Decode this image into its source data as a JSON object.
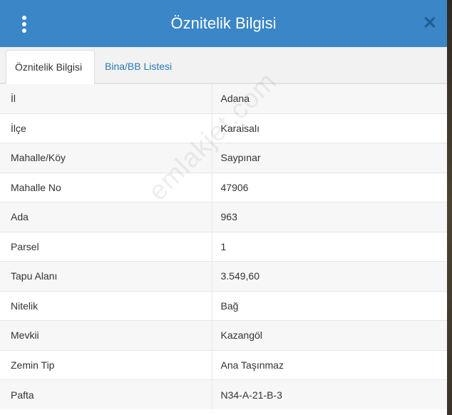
{
  "header": {
    "title": "Öznitelik Bilgisi"
  },
  "tabs": [
    {
      "label": "Öznitelik Bilgisi",
      "active": true
    },
    {
      "label": "Bina/BB Listesi",
      "active": false
    }
  ],
  "rows": [
    {
      "label": "İl",
      "value": "Adana"
    },
    {
      "label": "İlçe",
      "value": "Karaisalı"
    },
    {
      "label": "Mahalle/Köy",
      "value": "Saypınar"
    },
    {
      "label": "Mahalle No",
      "value": "47906"
    },
    {
      "label": "Ada",
      "value": "963"
    },
    {
      "label": "Parsel",
      "value": "1"
    },
    {
      "label": "Tapu Alanı",
      "value": "3.549,60"
    },
    {
      "label": "Nitelik",
      "value": "Bağ"
    },
    {
      "label": "Mevkii",
      "value": "Kazangöl"
    },
    {
      "label": "Zemin Tip",
      "value": "Ana Taşınmaz"
    },
    {
      "label": "Pafta",
      "value": "N34-A-21-B-3"
    }
  ],
  "watermark": "emlakjet.com",
  "icons": {
    "menu": "kebab-menu-icon",
    "close": "close-icon"
  },
  "colors": {
    "header": "#3a86c6",
    "tab_link": "#2a7ab8"
  }
}
